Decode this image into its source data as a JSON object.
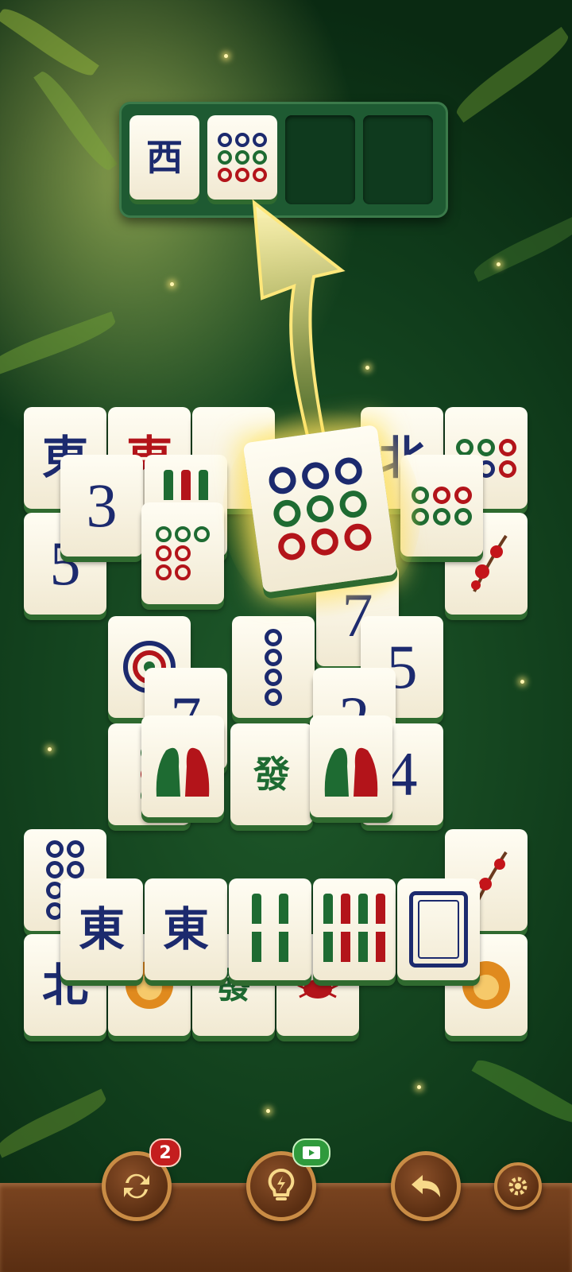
{
  "tray": {
    "slot1": {
      "char": "西"
    },
    "slot2": {
      "dots": [
        "b",
        "b",
        "b",
        "g",
        "g",
        "g",
        "r",
        "r",
        "r"
      ]
    }
  },
  "board": {
    "top_row_chars": [
      "東",
      "東",
      "北"
    ],
    "num3": "3",
    "num7": "7",
    "num2": "2",
    "num4": "4",
    "num5": "5",
    "char_fa": "發",
    "char_bei": "北",
    "bottom_row": [
      "東",
      "東"
    ]
  },
  "bottom_bar": {
    "shuffle_badge": "2"
  },
  "icons": {
    "shuffle": "shuffle-icon",
    "hint": "lightbulb-icon",
    "video": "video-icon",
    "undo": "undo-icon",
    "settings": "gear-icon"
  }
}
